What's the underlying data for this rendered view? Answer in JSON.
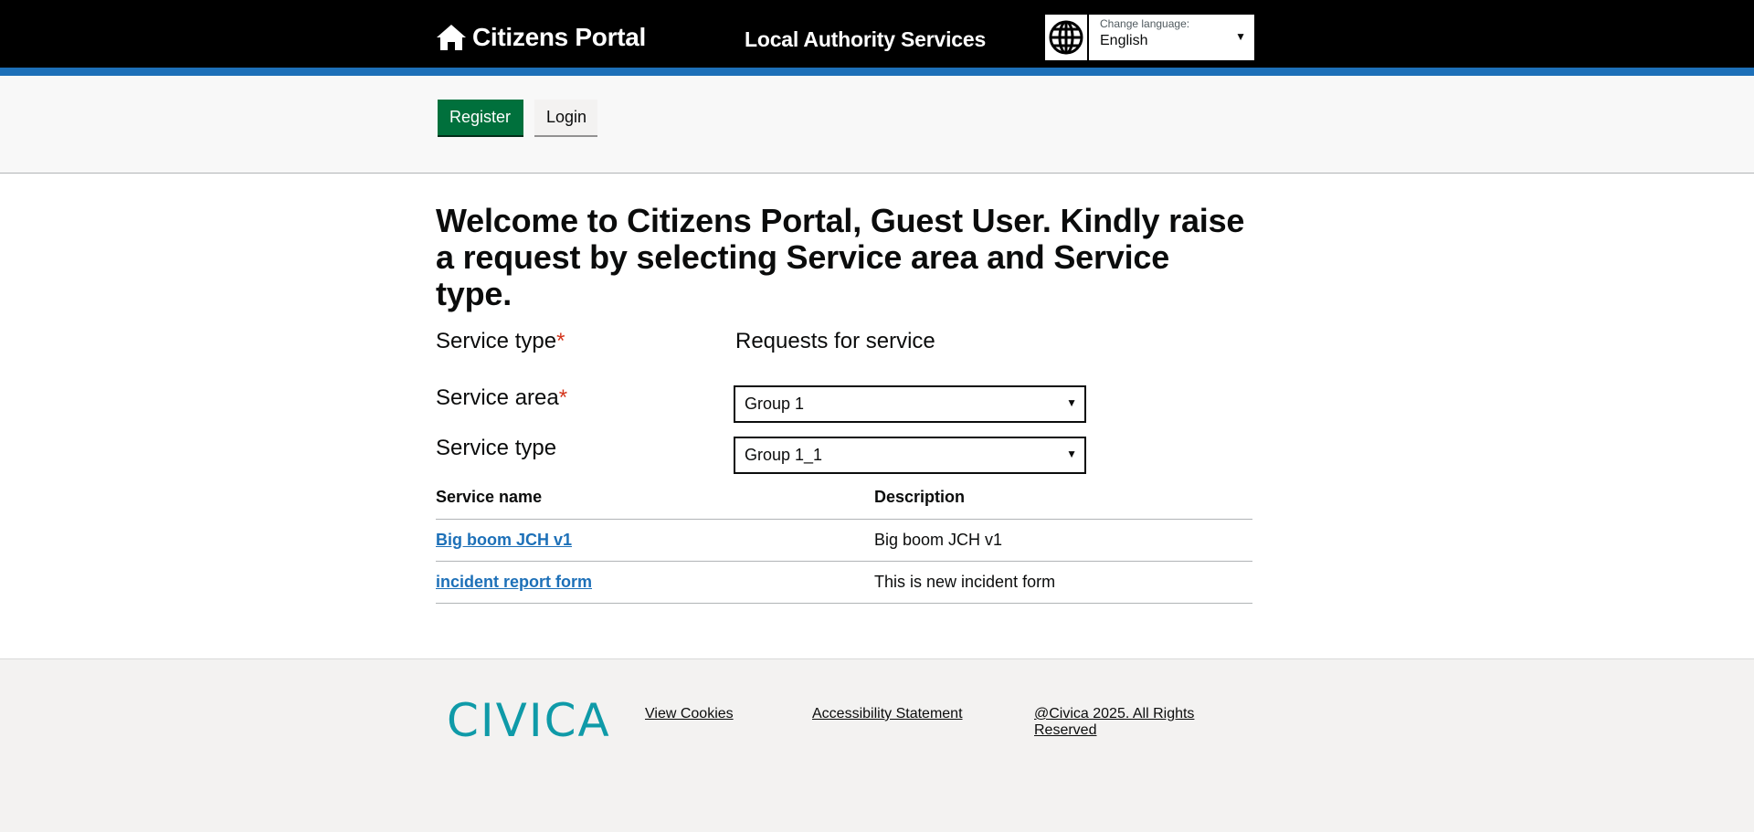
{
  "header": {
    "brand": "Citizens Portal",
    "service_name": "Local Authority Services",
    "language": {
      "caption": "Change language:",
      "value": "English"
    }
  },
  "nav": {
    "register": "Register",
    "login": "Login"
  },
  "main": {
    "heading": "Welcome to Citizens Portal, Guest User. Kindly raise a request by selecting Service area and Service type.",
    "fields": {
      "service_type_label": "Service type",
      "service_type_value": "Requests for service",
      "service_area_label": "Service area",
      "service_area_value": "Group 1",
      "service_type2_label": "Service type",
      "service_type2_value": "Group 1_1",
      "required_mark": "*"
    },
    "table": {
      "headers": [
        "Service name",
        "Description"
      ],
      "rows": [
        {
          "name": "Big boom JCH v1",
          "description": "Big boom JCH v1"
        },
        {
          "name": "incident report form",
          "description": "This is new incident form"
        }
      ]
    }
  },
  "footer": {
    "logo": "CIVICA",
    "links": [
      "View Cookies",
      "Accessibility Statement",
      "@Civica 2025. All Rights Reserved"
    ]
  },
  "colors": {
    "header_bg": "#000000",
    "accent_blue": "#1d70b8",
    "register_green": "#00703c",
    "logo_teal": "#0f9aa8"
  }
}
